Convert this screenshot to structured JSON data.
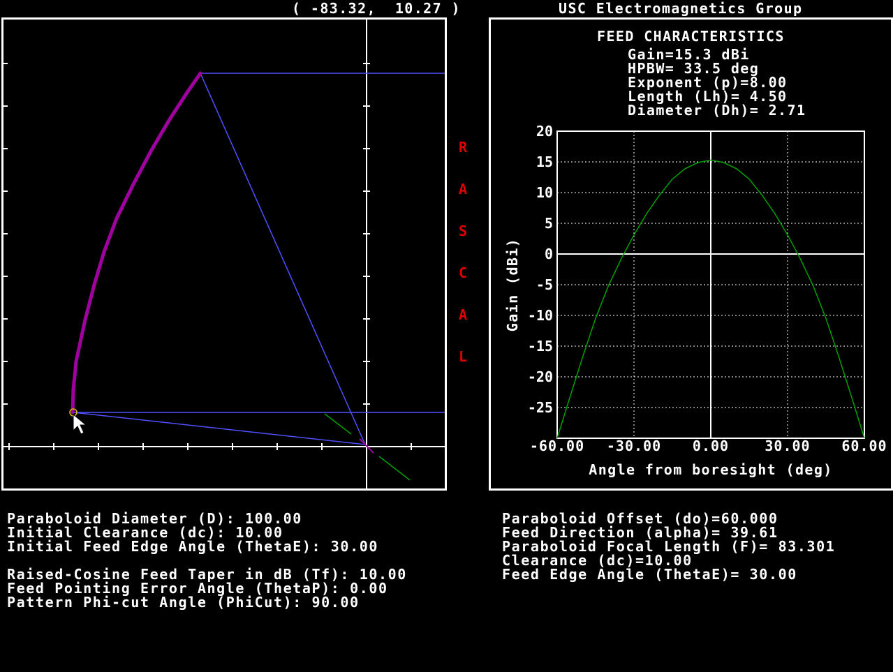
{
  "header": {
    "cursor_coords": "( -83.32,  10.27 )",
    "group_name": "USC Electromagnetics Group"
  },
  "side_label": [
    "R",
    "A",
    "S",
    "C",
    "A",
    "L"
  ],
  "feed": {
    "title": "FEED CHARACTERISTICS",
    "lines": [
      "Gain=15.3 dBi",
      "HPBW= 33.5 deg",
      "Exponent (p)=8.00",
      "Length (Lh)= 4.50",
      "Diameter (Dh)= 2.71"
    ]
  },
  "left_params": [
    "Paraboloid Diameter (D): 100.00",
    "Initial Clearance (dc): 10.00",
    "Initial Feed Edge Angle (ThetaE): 30.00",
    "",
    "Raised-Cosine Feed Taper in dB (Tf): 10.00",
    "Feed Pointing Error Angle (ThetaP): 0.00",
    "Pattern Phi-cut Angle (PhiCut): 90.00"
  ],
  "right_params": [
    "Paraboloid Offset (do)=60.000",
    "Feed Direction (alpha)= 39.61",
    "Paraboloid Focal Length (F)= 83.301",
    "Clearance (dc)=10.00",
    "Feed Edge Angle (ThetaE)= 30.00"
  ],
  "colors": {
    "reflector": "#a000a0",
    "rays": "#5050ff",
    "feed_axis": "#00a000",
    "pattern": "#00a000",
    "rascal": "#e00000"
  },
  "chart_data": {
    "type": "line",
    "title": "",
    "xlabel": "Angle from boresight (deg)",
    "ylabel": "Gain (dBi)",
    "xlim": [
      -60,
      60
    ],
    "ylim": [
      -30,
      20
    ],
    "x_ticks": [
      "-60.00",
      "-30.00",
      "0.00",
      "30.00",
      "60.00"
    ],
    "y_ticks": [
      "20",
      "15",
      "10",
      "5",
      "0",
      "-5",
      "-10",
      "-15",
      "-20",
      "-25"
    ],
    "grid": true,
    "series": [
      {
        "x": [
          -60,
          -55,
          -50,
          -45,
          -40,
          -35,
          -30,
          -25,
          -20,
          -15,
          -10,
          -5,
          0,
          5,
          10,
          15,
          20,
          25,
          30,
          35,
          40,
          45,
          50,
          55,
          60
        ],
        "values": [
          -30.0,
          -23.3,
          -16.7,
          -10.5,
          -5.2,
          -0.8,
          3.1,
          6.6,
          9.6,
          12.2,
          13.9,
          14.9,
          15.3,
          14.9,
          13.9,
          12.2,
          9.6,
          6.6,
          3.1,
          -0.8,
          -5.2,
          -10.5,
          -16.7,
          -23.3,
          -30.0
        ]
      }
    ]
  }
}
